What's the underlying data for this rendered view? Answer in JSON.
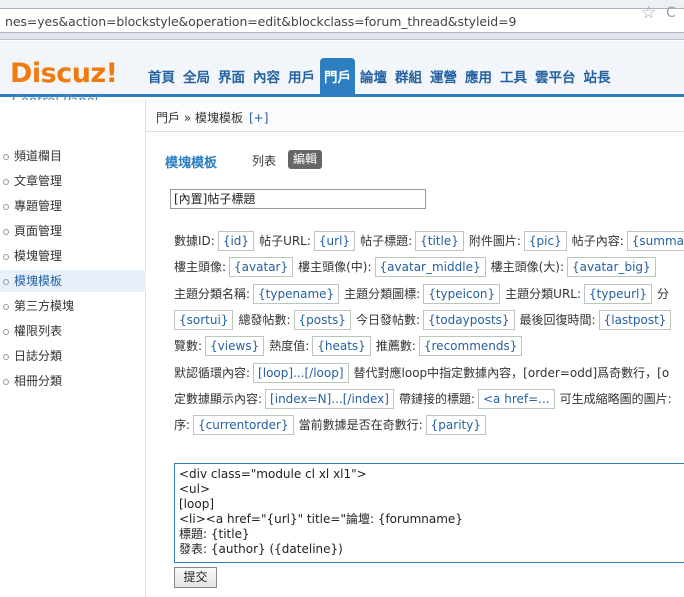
{
  "browser": {
    "url": "nes=yes&action=blockstyle&operation=edit&blockclass=forum_thread&styleid=9"
  },
  "brand": {
    "logo": "Discuz!",
    "subtitle": "Control Panel"
  },
  "nav": {
    "items": [
      "首頁",
      "全局",
      "界面",
      "內容",
      "用戶",
      "門戶",
      "論壇",
      "群組",
      "運營",
      "應用",
      "工具",
      "雲平台",
      "站長"
    ],
    "active_index": 5
  },
  "sidebar": {
    "items": [
      "頻道欄目",
      "文章管理",
      "專題管理",
      "頁面管理",
      "模塊管理",
      "模塊模板",
      "第三方模塊",
      "權限列表",
      "日誌分類",
      "相冊分類"
    ],
    "active_index": 5
  },
  "breadcrumb": {
    "text": "門戶 » 模塊模板",
    "add": "[+]"
  },
  "page": {
    "title": "模塊模板",
    "tab_list": "列表",
    "tab_edit": "編輯"
  },
  "form": {
    "name_value": "[內置]帖子標題",
    "submit_label": "提交",
    "template_lines": [
      "<div class=\"module cl xl xl1\">",
      "<ul>",
      "[loop]",
      "<li><a href=\"{url}\" title=\"論壇: {forumname}",
      "標題: {title}",
      "發表: {author} ({dateline})"
    ]
  },
  "vars": {
    "line1": {
      "l1": "數據ID:",
      "t1": "{id}",
      "l2": "帖子URL:",
      "t2": "{url}",
      "l3": "帖子標題:",
      "t3": "{title}",
      "l4": "附件圖片:",
      "t4": "{pic}",
      "l5": "帖子內容:",
      "t5": "{summary}"
    },
    "line2": {
      "l1": "樓主頭像:",
      "t1": "{avatar}",
      "l2": "樓主頭像(中):",
      "t2": "{avatar_middle}",
      "l3": "樓主頭像(大):",
      "t3": "{avatar_big}"
    },
    "line3": {
      "l1": "主題分類名稱:",
      "t1": "{typename}",
      "l2": "主題分類圖標:",
      "t2": "{typeicon}",
      "l3": "主題分類URL:",
      "t3": "{typeurl}",
      "l4": "分"
    },
    "line4": {
      "t1": "{sortui}",
      "l2": "總發帖數:",
      "t2": "{posts}",
      "l3": "今日發帖數:",
      "t3": "{todayposts}",
      "l4": "最後回復時間:",
      "t4": "{lastpost}"
    },
    "line5": {
      "l1": "覽數:",
      "t1": "{views}",
      "l2": "熱度值:",
      "t2": "{heats}",
      "l3": "推薦數:",
      "t3": "{recommends}"
    },
    "line6": {
      "l1": "默認循環內容:",
      "t1": "[loop]...[/loop]",
      "l2": "替代對應loop中指定數據內容，[order=odd]爲奇數行，[o"
    },
    "line7": {
      "l1": "定數據顯示內容:",
      "t1": "[index=N]...[/index]",
      "l2": "帶鏈接的標題:",
      "t2": "<a href=...",
      "l3": "可生成縮略圖的圖片:"
    },
    "line8": {
      "l1": "序:",
      "t1": "{currentorder}",
      "l2": "當前數據是否在奇數行:",
      "t2": "{parity}"
    }
  }
}
